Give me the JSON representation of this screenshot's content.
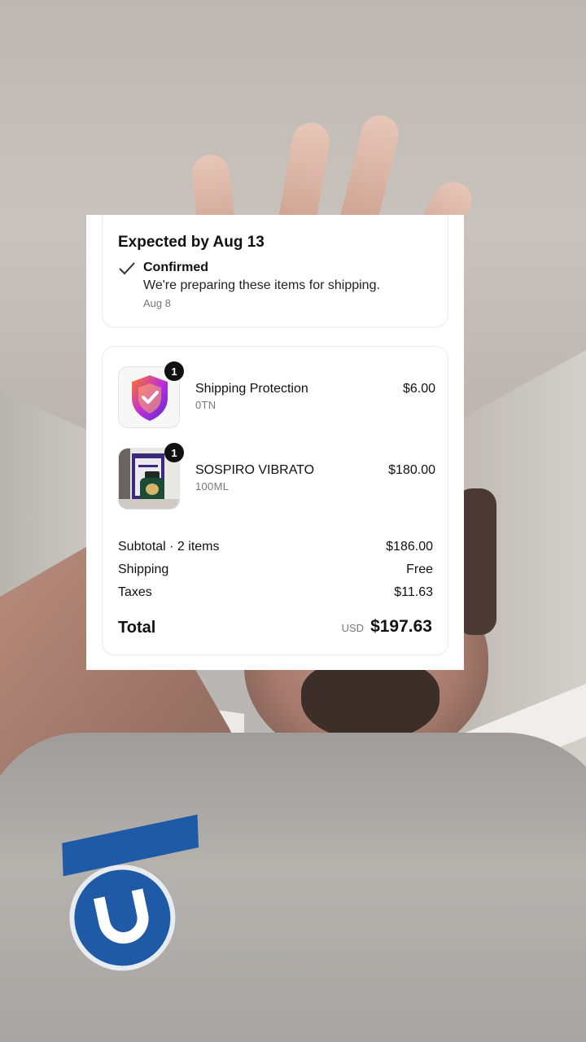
{
  "order_status": {
    "expected": "Expected by Aug 13",
    "status_title": "Confirmed",
    "status_desc": "We're preparing these items for shipping.",
    "status_date": "Aug 8"
  },
  "items": [
    {
      "name": "Shipping Protection",
      "variant": "0TN",
      "price": "$6.00",
      "quantity": "1",
      "icon": "shield-check-icon"
    },
    {
      "name": "SOSPIRO VIBRATO",
      "variant": "100ML",
      "price": "$180.00",
      "quantity": "1",
      "icon": "perfume-bottle-image"
    }
  ],
  "summary": {
    "subtotal_label": "Subtotal · 2 items",
    "subtotal_value": "$186.00",
    "shipping_label": "Shipping",
    "shipping_value": "Free",
    "taxes_label": "Taxes",
    "taxes_value": "$11.63",
    "total_label": "Total",
    "total_currency": "USD",
    "total_value": "$197.63"
  },
  "colors": {
    "badge": "#111111",
    "shield_gradient": [
      "#8a2be2",
      "#ff7a1a"
    ]
  }
}
